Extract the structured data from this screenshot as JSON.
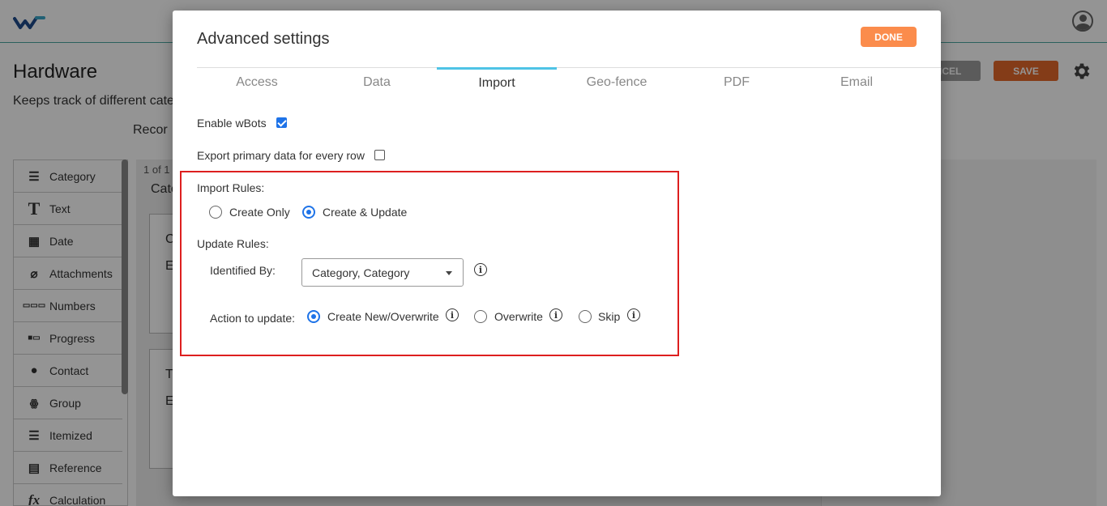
{
  "app": {
    "page_title": "Hardware",
    "page_description": "Keeps track of different cate",
    "records_tab": "Recor",
    "cancel_label": "NCEL",
    "save_label": "SAVE"
  },
  "field_panel": {
    "items": [
      {
        "label": "Category",
        "icon": "list-icon"
      },
      {
        "label": "Text",
        "icon": "text-icon"
      },
      {
        "label": "Date",
        "icon": "calendar-icon"
      },
      {
        "label": "Attachments",
        "icon": "paperclip-icon"
      },
      {
        "label": "Numbers",
        "icon": "numbers-icon"
      },
      {
        "label": "Progress",
        "icon": "progress-icon"
      },
      {
        "label": "Contact",
        "icon": "contact-icon"
      },
      {
        "label": "Group",
        "icon": "group-icon"
      },
      {
        "label": "Itemized",
        "icon": "itemized-list-icon"
      },
      {
        "label": "Reference",
        "icon": "document-icon"
      },
      {
        "label": "Calculation",
        "icon": "fx-icon"
      }
    ]
  },
  "canvas": {
    "pager": "1 of 1",
    "category_tab": "Cate",
    "card1_letters": [
      "C",
      "E"
    ],
    "card2_letters": [
      "T",
      "E"
    ]
  },
  "modal": {
    "title": "Advanced settings",
    "done_label": "DONE",
    "tabs": [
      "Access",
      "Data",
      "Import",
      "Geo-fence",
      "PDF",
      "Email"
    ],
    "active_tab": "Import",
    "enable_wbots": {
      "label": "Enable wBots",
      "checked": true
    },
    "export_primary": {
      "label": "Export primary data for every row",
      "checked": false
    },
    "import_rules": {
      "label": "Import Rules:",
      "options": [
        {
          "label": "Create Only",
          "selected": false
        },
        {
          "label": "Create & Update",
          "selected": true
        }
      ]
    },
    "update_rules": {
      "label": "Update Rules:",
      "identified_by_label": "Identified By:",
      "identified_by_value": "Category, Category",
      "action_label": "Action to update:",
      "actions": [
        {
          "label": "Create New/Overwrite",
          "selected": true
        },
        {
          "label": "Overwrite",
          "selected": false
        },
        {
          "label": "Skip",
          "selected": false
        }
      ]
    },
    "info_glyph": "i"
  },
  "colors": {
    "accent_blue": "#1e73e8",
    "done_orange": "#fb8c4c",
    "save_orange": "#e3682a",
    "highlight_red": "#dd1f1f",
    "tab_indicator": "#4fc3e6"
  }
}
